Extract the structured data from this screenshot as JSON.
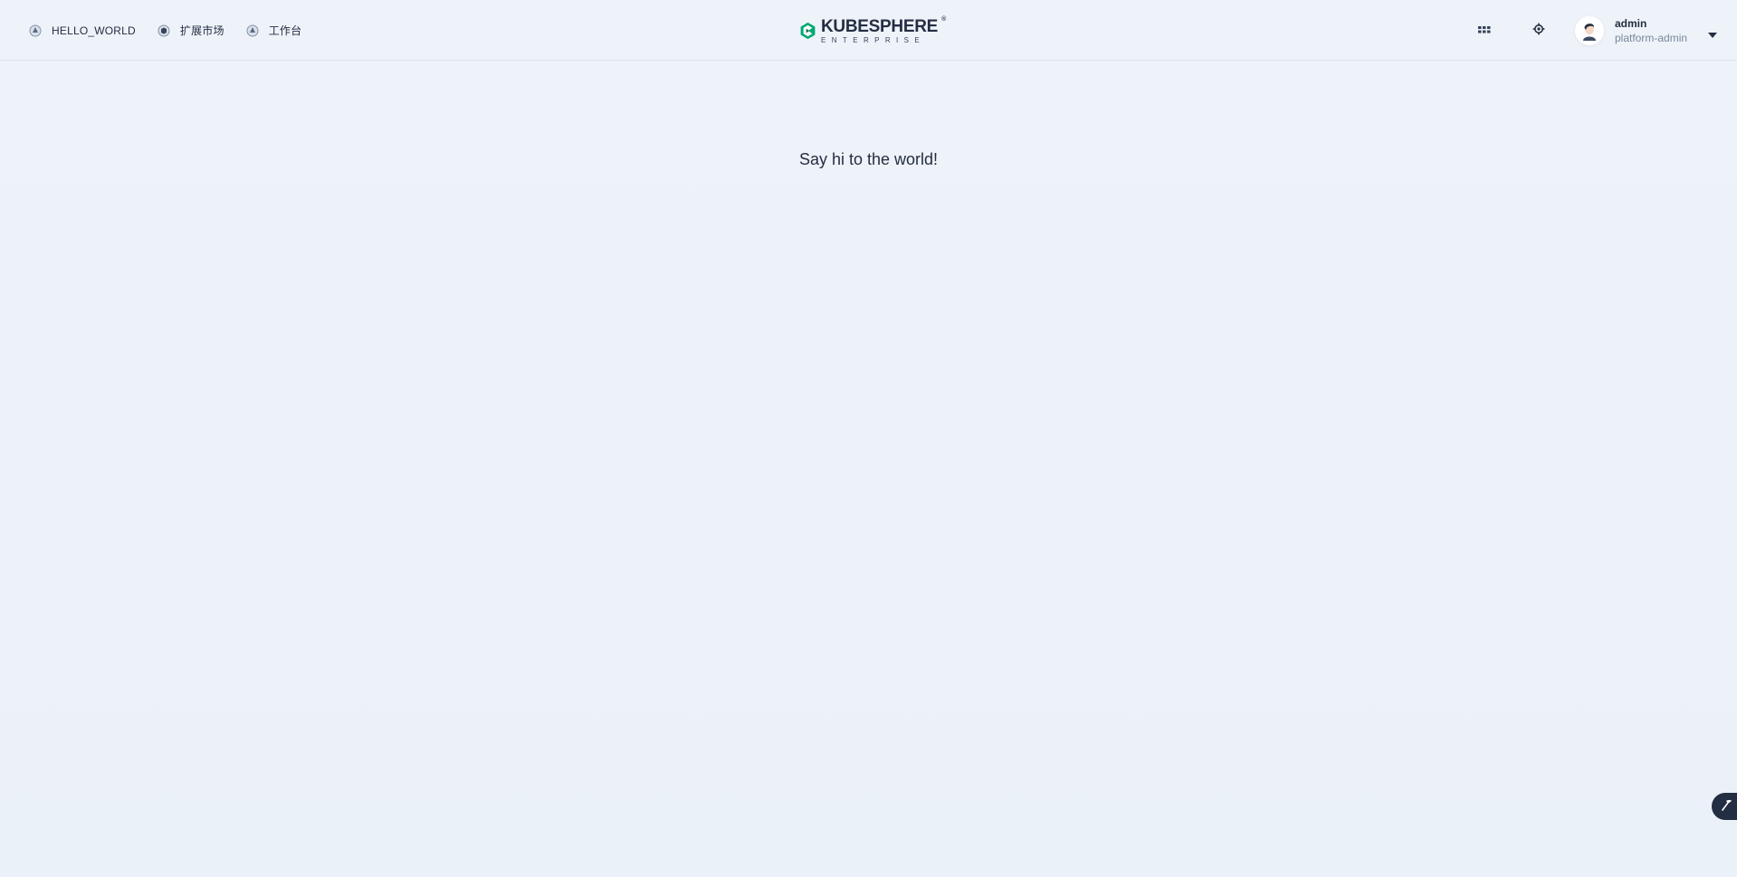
{
  "nav": {
    "items": [
      {
        "label": "HELLO_WORLD",
        "icon": "cluster-icon"
      },
      {
        "label": "扩展市场",
        "icon": "marketplace-icon"
      },
      {
        "label": "工作台",
        "icon": "workbench-icon"
      }
    ]
  },
  "logo": {
    "main": "KUBESPHERE",
    "registered": "®",
    "sub": "ENTERPRISE",
    "brand_color": "#00a971"
  },
  "header_right": {
    "apps_icon": "app-grid-icon",
    "settings_icon": "gear-icon"
  },
  "user": {
    "name": "admin",
    "role": "platform-admin"
  },
  "main": {
    "message": "Say hi to the world!"
  },
  "colors": {
    "background": "#ecf2f9",
    "text": "#242e42",
    "muted": "#79879c"
  }
}
